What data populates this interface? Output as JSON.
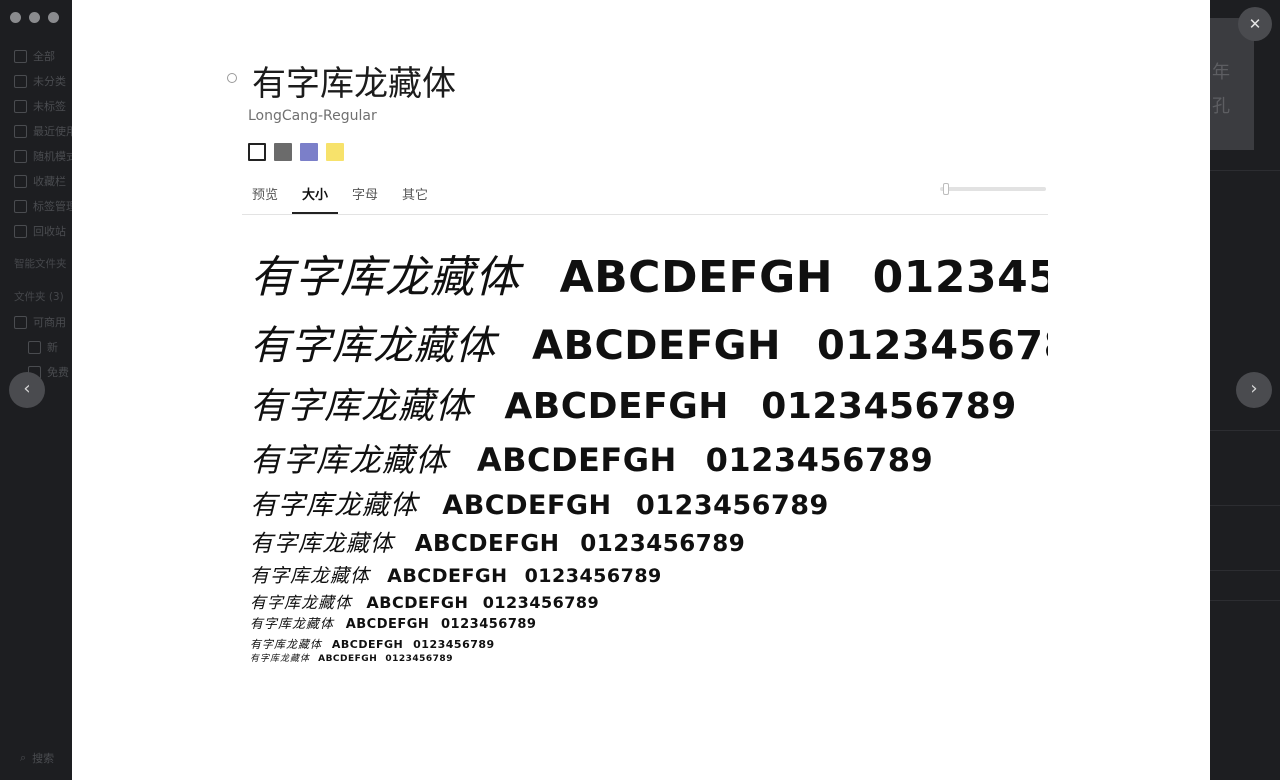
{
  "window": {
    "controls": [
      "close",
      "minimize",
      "zoom"
    ]
  },
  "background": {
    "sidebar_items": [
      "全部",
      "未分类",
      "未标签",
      "最近使用",
      "随机模式",
      "收藏栏",
      "标签管理",
      "回收站"
    ],
    "sections": [
      "智能文件夹",
      "文件夹 (3)",
      "可商用",
      "新",
      "免费"
    ],
    "search_label": "搜索",
    "card_text": [
      "年",
      "孔"
    ]
  },
  "font": {
    "name": "有字库龙藏体",
    "postscript_name": "LongCang-Regular",
    "colors": [
      "#ffffff",
      "#6b6b6b",
      "#7b7fc9",
      "#f7e26b"
    ]
  },
  "tabs": [
    {
      "label": "预览",
      "active": false
    },
    {
      "label": "大小",
      "active": true
    },
    {
      "label": "字母",
      "active": false
    },
    {
      "label": "其它",
      "active": false
    }
  ],
  "size_slider": {
    "value": 0.05
  },
  "sample": {
    "chinese": "有字库龙藏体",
    "latin": "ABCDEFGH",
    "digits": "0123456789"
  },
  "icons": {
    "close": "close-icon",
    "prev": "chevron-left-icon",
    "next": "chevron-right-icon"
  }
}
